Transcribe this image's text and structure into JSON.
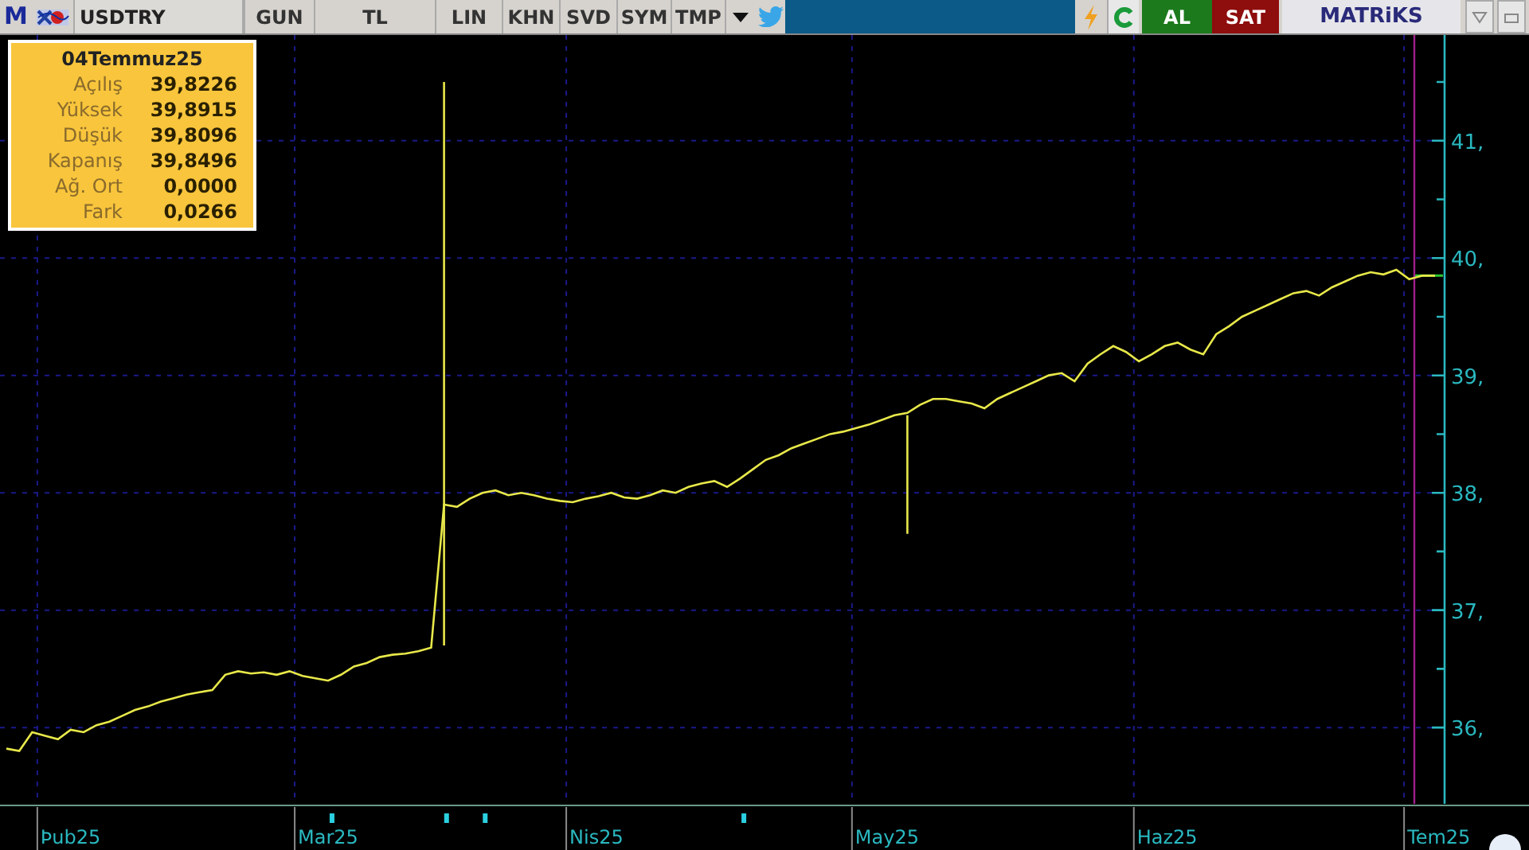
{
  "toolbar": {
    "logo": "M",
    "symbol": "USDTRY",
    "buttons": [
      "GUN",
      "TL",
      "LIN",
      "KHN",
      "SVD",
      "SYM",
      "TMP"
    ],
    "buy": "AL",
    "sell": "SAT",
    "brand": "MATRiKS"
  },
  "info_box": {
    "date": "04Temmuz25",
    "rows": [
      {
        "label": "Açılış",
        "value": "39,8226"
      },
      {
        "label": "Yüksek",
        "value": "39,8915"
      },
      {
        "label": "Düşük",
        "value": "39,8096"
      },
      {
        "label": "Kapanış",
        "value": "39,8496"
      },
      {
        "label": "Ağ. Ort",
        "value": "0,0000"
      },
      {
        "label": "Fark",
        "value": "0,0266"
      }
    ]
  },
  "chart": {
    "x_labels": [
      "Þub25",
      "Mar25",
      "Nis25",
      "May25",
      "Haz25",
      "Tem25"
    ],
    "chart_data": {
      "type": "line",
      "grid": true,
      "ylim": [
        35.35,
        41.9
      ],
      "yticks": [
        {
          "value": 36,
          "label": "36,"
        },
        {
          "value": 37,
          "label": "37,"
        },
        {
          "value": 38,
          "label": "38,"
        },
        {
          "value": 39,
          "label": "39,"
        },
        {
          "value": 40,
          "label": "40,"
        },
        {
          "value": 41,
          "label": "41,"
        }
      ],
      "series": [
        {
          "color": "#e8e84a",
          "values": [
            35.82,
            35.8,
            35.96,
            35.93,
            35.9,
            35.98,
            35.96,
            36.02,
            36.05,
            36.1,
            36.15,
            36.18,
            36.22,
            36.25,
            36.28,
            36.3,
            36.32,
            36.45,
            36.48,
            36.46,
            36.47,
            36.45,
            36.48,
            36.44,
            36.42,
            36.4,
            36.45,
            36.52,
            36.55,
            36.6,
            36.62,
            36.63,
            36.65,
            36.68,
            37.9,
            37.88,
            37.95,
            38.0,
            38.02,
            37.98,
            38.0,
            37.98,
            37.95,
            37.93,
            37.92,
            37.95,
            37.97,
            38.0,
            37.96,
            37.95,
            37.98,
            38.02,
            38.0,
            38.05,
            38.08,
            38.1,
            38.05,
            38.12,
            38.2,
            38.28,
            38.32,
            38.38,
            38.42,
            38.46,
            38.5,
            38.52,
            38.55,
            38.58,
            38.62,
            38.66,
            38.68,
            38.75,
            38.8,
            38.8,
            38.78,
            38.76,
            38.72,
            38.8,
            38.85,
            38.9,
            38.95,
            39.0,
            39.02,
            38.95,
            39.1,
            39.18,
            39.25,
            39.2,
            39.12,
            39.18,
            39.25,
            39.28,
            39.22,
            39.18,
            39.35,
            39.42,
            39.5,
            39.55,
            39.6,
            39.65,
            39.7,
            39.72,
            39.68,
            39.75,
            39.8,
            39.85,
            39.88,
            39.86,
            39.9,
            39.82,
            39.85,
            39.85
          ]
        }
      ]
    }
  }
}
